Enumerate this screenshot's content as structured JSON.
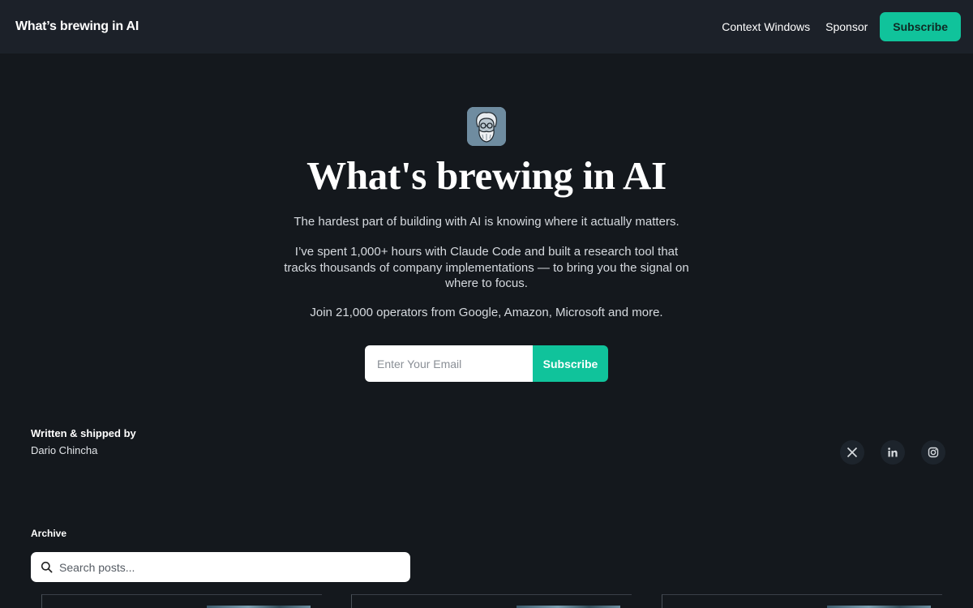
{
  "header": {
    "brand": "What’s brewing in AI",
    "nav": [
      {
        "label": "Context Windows"
      },
      {
        "label": "Sponsor"
      }
    ],
    "subscribe_label": "Subscribe"
  },
  "hero": {
    "logo_icon": "bearded-avatar-icon",
    "title": "What's brewing in AI",
    "paragraph1": "The hardest part of building with AI is knowing where it actually matters.",
    "paragraph2": "I’ve spent 1,000+ hours with Claude Code and built a research tool that tracks thousands of company implementations — to bring you the signal on where to focus.",
    "paragraph3": "Join 21,000 operators from Google, Amazon, Microsoft and more.",
    "email_placeholder": "Enter Your Email",
    "subscribe_label": "Subscribe"
  },
  "author": {
    "title": "Written & shipped by",
    "name": "Dario Chincha"
  },
  "socials": [
    {
      "icon": "x-icon"
    },
    {
      "icon": "linkedin-icon"
    },
    {
      "icon": "instagram-icon"
    }
  ],
  "archive": {
    "label": "Archive",
    "search_placeholder": "Search posts..."
  },
  "colors": {
    "accent": "#10c39b",
    "background": "#14181d",
    "header_bg": "#1c2129"
  }
}
